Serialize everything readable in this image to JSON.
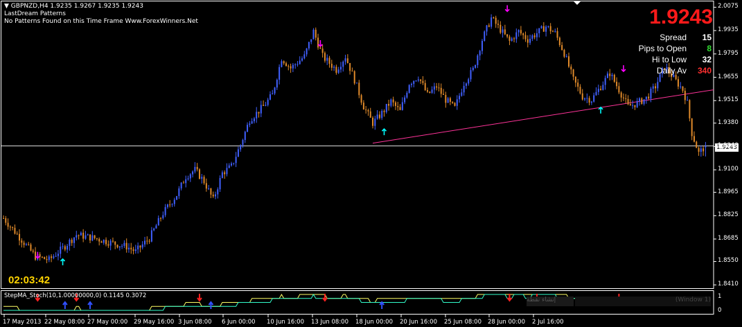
{
  "header": {
    "symbol_line": "GBPNZD,H4  1.9235 1.9267 1.9235 1.9243",
    "indicator_name": "LastDream Patterns",
    "indicator_status": "No Patterns Found on this Time Frame Www.ForexWinners.Net"
  },
  "price_panel": {
    "current_price": "1.9243",
    "stats": [
      {
        "label": "Spread",
        "value": "15",
        "color": "#ffffff"
      },
      {
        "label": "Pips to Open",
        "value": "8",
        "color": "#33dd33"
      },
      {
        "label": "Hi to Low",
        "value": "32",
        "color": "#ffffff"
      },
      {
        "label": "Daily Av",
        "value": "340",
        "color": "#ff3030"
      }
    ]
  },
  "countdown": "02:03:42",
  "price_axis_box": "1.9243",
  "subwindow": {
    "title": "StepMA_Stoch(10,1.00000000,0) 0.1145 0.3072",
    "axis_labels": [
      "1",
      "0"
    ],
    "watermark_left": "إنشاء نقطة",
    "watermark_right": "(Window 1)"
  },
  "chart_data": {
    "type": "candlestick",
    "symbol": "GBPNZD",
    "timeframe": "H4",
    "ohlc_last": {
      "open": 1.9235,
      "high": 1.9267,
      "low": 1.9235,
      "close": 1.9243
    },
    "ylim": [
      1.839,
      2.011
    ],
    "y_ticks": [
      "2.0075",
      "1.9935",
      "1.9795",
      "1.9655",
      "1.9515",
      "1.9380",
      "1.9240",
      "1.9100",
      "1.8965",
      "1.8825",
      "1.8685",
      "1.8550",
      "1.8410"
    ],
    "x_ticks": [
      "17 May 2013",
      "22 May 08:00",
      "27 May 00:00",
      "29 May 16:00",
      "3 Jun 08:00",
      "6 Jun 00:00",
      "10 Jun 16:00",
      "13 Jun 08:00",
      "18 Jun 00:00",
      "20 Jun 16:00",
      "25 Jun 08:00",
      "28 Jun 00:00",
      "2 Jul 16:00"
    ],
    "close_path": [
      {
        "i": 0,
        "c": 1.881
      },
      {
        "i": 8,
        "c": 1.868
      },
      {
        "i": 14,
        "c": 1.858
      },
      {
        "i": 20,
        "c": 1.856
      },
      {
        "i": 26,
        "c": 1.863
      },
      {
        "i": 32,
        "c": 1.871
      },
      {
        "i": 40,
        "c": 1.869
      },
      {
        "i": 48,
        "c": 1.866
      },
      {
        "i": 54,
        "c": 1.864
      },
      {
        "i": 58,
        "c": 1.861
      },
      {
        "i": 64,
        "c": 1.869
      },
      {
        "i": 70,
        "c": 1.884
      },
      {
        "i": 76,
        "c": 1.895
      },
      {
        "i": 80,
        "c": 1.906
      },
      {
        "i": 84,
        "c": 1.91
      },
      {
        "i": 88,
        "c": 1.903
      },
      {
        "i": 92,
        "c": 1.892
      },
      {
        "i": 96,
        "c": 1.908
      },
      {
        "i": 100,
        "c": 1.912
      },
      {
        "i": 104,
        "c": 1.925
      },
      {
        "i": 108,
        "c": 1.94
      },
      {
        "i": 114,
        "c": 1.948
      },
      {
        "i": 118,
        "c": 1.955
      },
      {
        "i": 122,
        "c": 1.977
      },
      {
        "i": 126,
        "c": 1.971
      },
      {
        "i": 132,
        "c": 1.978
      },
      {
        "i": 136,
        "c": 1.993
      },
      {
        "i": 140,
        "c": 1.978
      },
      {
        "i": 146,
        "c": 1.97
      },
      {
        "i": 150,
        "c": 1.978
      },
      {
        "i": 154,
        "c": 1.964
      },
      {
        "i": 158,
        "c": 1.948
      },
      {
        "i": 162,
        "c": 1.938
      },
      {
        "i": 166,
        "c": 1.944
      },
      {
        "i": 170,
        "c": 1.951
      },
      {
        "i": 174,
        "c": 1.945
      },
      {
        "i": 178,
        "c": 1.962
      },
      {
        "i": 182,
        "c": 1.966
      },
      {
        "i": 186,
        "c": 1.955
      },
      {
        "i": 190,
        "c": 1.96
      },
      {
        "i": 194,
        "c": 1.952
      },
      {
        "i": 198,
        "c": 1.947
      },
      {
        "i": 202,
        "c": 1.962
      },
      {
        "i": 206,
        "c": 1.97
      },
      {
        "i": 210,
        "c": 1.988
      },
      {
        "i": 214,
        "c": 2.001
      },
      {
        "i": 218,
        "c": 1.994
      },
      {
        "i": 222,
        "c": 1.987
      },
      {
        "i": 226,
        "c": 1.993
      },
      {
        "i": 230,
        "c": 1.988
      },
      {
        "i": 234,
        "c": 1.992
      },
      {
        "i": 238,
        "c": 1.996
      },
      {
        "i": 242,
        "c": 1.992
      },
      {
        "i": 246,
        "c": 1.98
      },
      {
        "i": 250,
        "c": 1.964
      },
      {
        "i": 254,
        "c": 1.954
      },
      {
        "i": 258,
        "c": 1.952
      },
      {
        "i": 262,
        "c": 1.96
      },
      {
        "i": 266,
        "c": 1.968
      },
      {
        "i": 270,
        "c": 1.958
      },
      {
        "i": 274,
        "c": 1.948
      },
      {
        "i": 278,
        "c": 1.95
      },
      {
        "i": 282,
        "c": 1.953
      },
      {
        "i": 286,
        "c": 1.96
      },
      {
        "i": 290,
        "c": 1.972
      },
      {
        "i": 294,
        "c": 1.965
      },
      {
        "i": 298,
        "c": 1.958
      },
      {
        "i": 300,
        "c": 1.95
      },
      {
        "i": 302,
        "c": 1.932
      },
      {
        "i": 305,
        "c": 1.92
      },
      {
        "i": 308,
        "c": 1.9243
      }
    ],
    "fractal_arrows": [
      {
        "i": 15,
        "price": 1.857,
        "dir": "down",
        "color": "#ff00ff"
      },
      {
        "i": 26,
        "price": 1.8565,
        "dir": "up",
        "color": "#00ffff"
      },
      {
        "i": 139,
        "price": 1.984,
        "dir": "down",
        "color": "#ff00ff"
      },
      {
        "i": 167,
        "price": 1.9345,
        "dir": "up",
        "color": "#00ffff"
      },
      {
        "i": 221,
        "price": 2.005,
        "dir": "down",
        "color": "#ff00ff"
      },
      {
        "i": 262,
        "price": 1.9475,
        "dir": "up",
        "color": "#00ffff"
      },
      {
        "i": 272,
        "price": 1.969,
        "dir": "down",
        "color": "#ff00ff"
      }
    ],
    "trendline": {
      "from_i": 162,
      "from_price": 1.926,
      "to_i": 340,
      "to_price": 1.958,
      "color": "#ff3399"
    },
    "hline": {
      "price": 1.9243,
      "color": "#ffffff"
    },
    "subwindow_signals": [
      {
        "i": 15,
        "dir": "down"
      },
      {
        "i": 27,
        "dir": "up"
      },
      {
        "i": 32,
        "dir": "down"
      },
      {
        "i": 38,
        "dir": "up"
      },
      {
        "i": 86,
        "dir": "down"
      },
      {
        "i": 91,
        "dir": "up"
      },
      {
        "i": 141,
        "dir": "down"
      },
      {
        "i": 166,
        "dir": "up"
      },
      {
        "i": 222,
        "dir": "down"
      },
      {
        "i": 234,
        "dir": "down"
      },
      {
        "i": 270,
        "dir": "down"
      }
    ],
    "colors": {
      "bull": "#4060ff",
      "bear": "#e08a2a",
      "grid": "#ffffff"
    }
  }
}
